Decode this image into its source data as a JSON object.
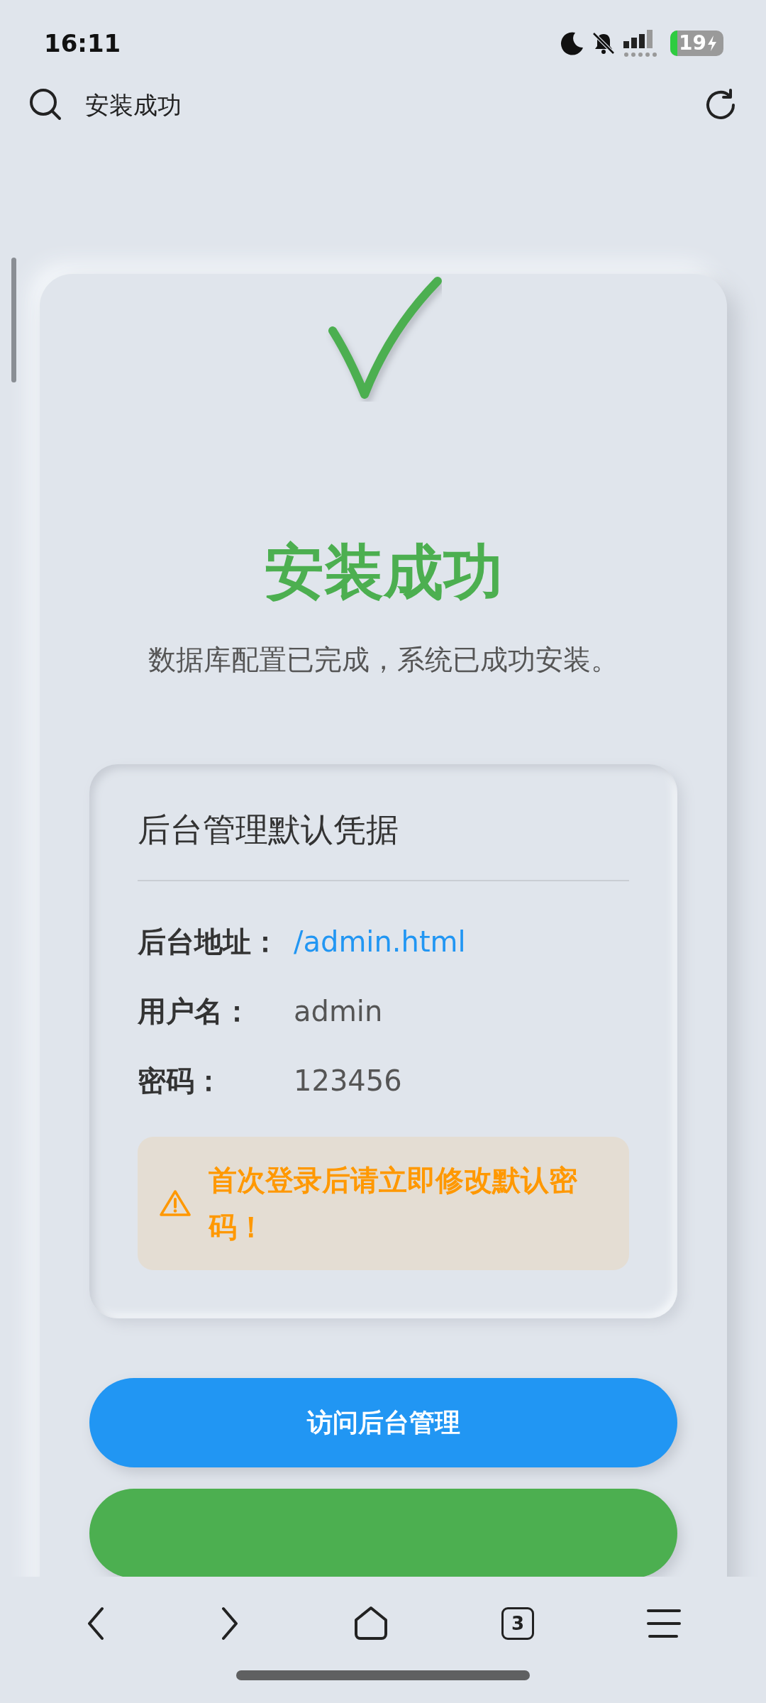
{
  "status_bar": {
    "time": "16:11",
    "battery": "19"
  },
  "address_bar": {
    "title": "安装成功"
  },
  "success": {
    "title": "安装成功",
    "message": "数据库配置已完成，系统已成功安装。"
  },
  "credentials": {
    "title": "后台管理默认凭据",
    "rows": [
      {
        "label": "后台地址：",
        "value": "/admin.html",
        "kind": "link"
      },
      {
        "label": "用户名：",
        "value": "admin",
        "kind": "text"
      },
      {
        "label": "密码：",
        "value": "123456",
        "kind": "text"
      }
    ],
    "warning": "首次登录后请立即修改默认密码！"
  },
  "buttons": [
    {
      "label": "访问后台管理",
      "kind": "primary"
    },
    {
      "kind": "success"
    }
  ],
  "bottom_nav": {
    "tabs_count": "3"
  }
}
